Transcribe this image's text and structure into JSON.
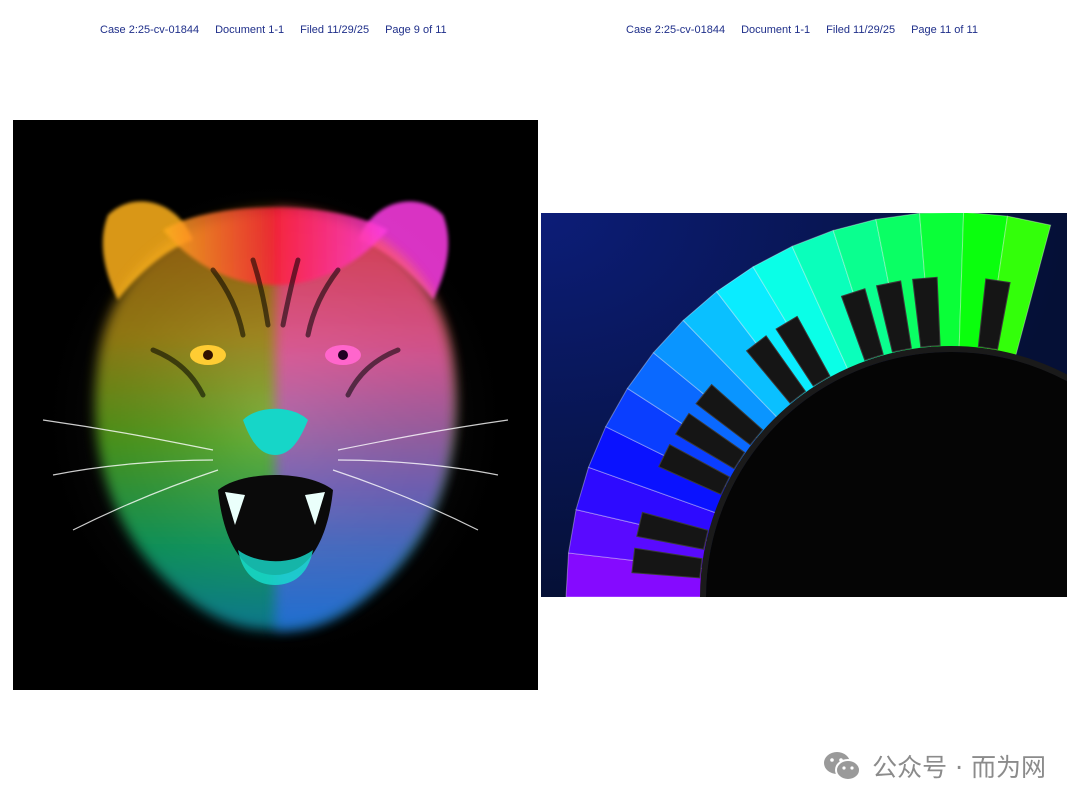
{
  "header_left": {
    "case": "Case 2:25-cv-01844",
    "document": "Document 1-1",
    "filed": "Filed 11/29/25",
    "page": "Page 9 of 11"
  },
  "header_right": {
    "case": "Case 2:25-cv-01844",
    "document": "Document 1-1",
    "filed": "Filed 11/29/25",
    "page": "Page 11 of 11"
  },
  "images": {
    "left": "rainbow-flame-tiger-head-artwork",
    "right": "rainbow-piano-keyboard-arc-artwork"
  },
  "footer": {
    "icon": "wechat-icon",
    "text": "公众号 · 而为网"
  },
  "colors": {
    "header_text": "#1f2f8a",
    "footer_text": "#8b8b8b",
    "panel_bg": "#000000",
    "piano_bg": "#0b1d63"
  }
}
